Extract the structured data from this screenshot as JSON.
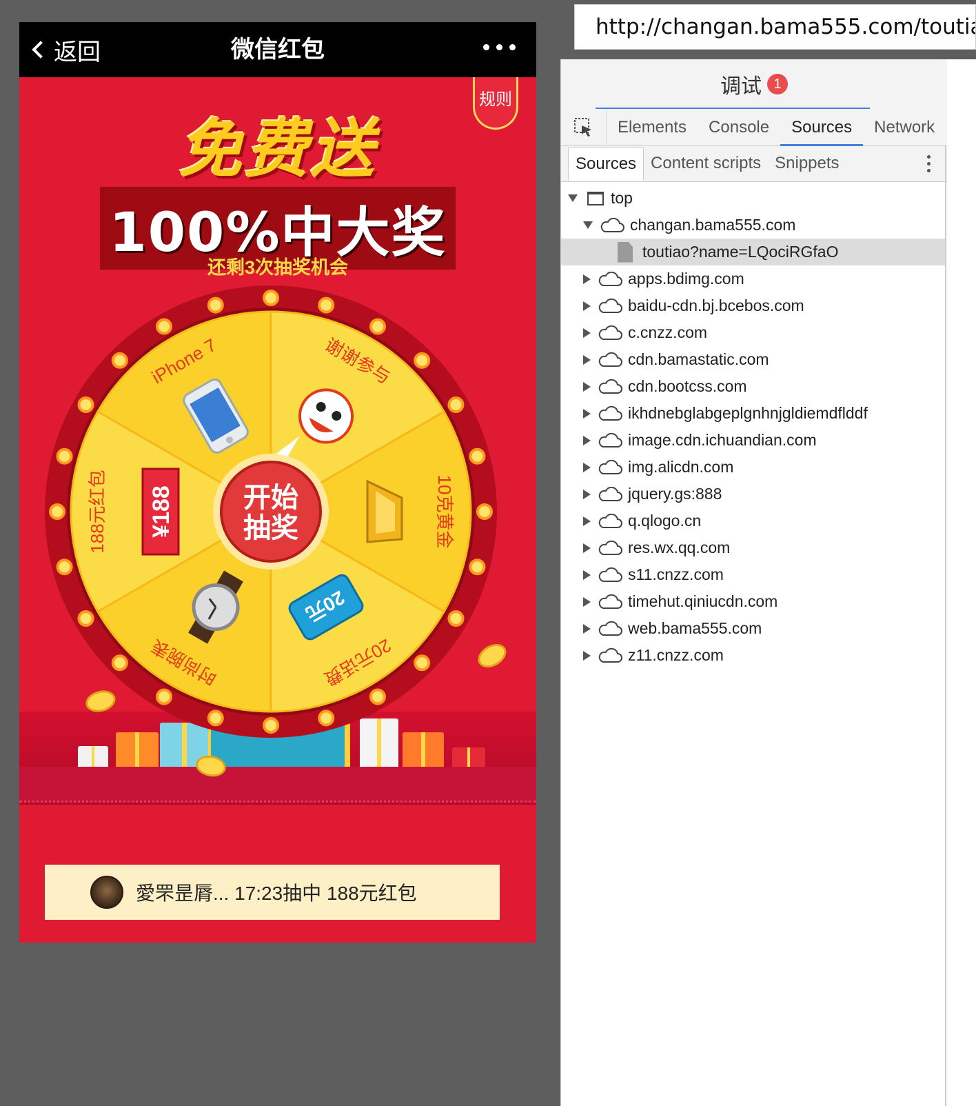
{
  "phone": {
    "back_label": "返回",
    "title": "微信红包",
    "rules_label": "规则",
    "headline_line1": "免费送",
    "headline_line2": "100%中大奖",
    "chances_text": "还剩3次抽奖机会",
    "start_button_line1": "开始",
    "start_button_line2": "抽奖",
    "wheel_segments": [
      {
        "label": "iPhone 7",
        "icon": "phone-icon"
      },
      {
        "label": "谢谢参与",
        "icon": "lion-dance-icon"
      },
      {
        "label": "10克黄金",
        "icon": "gold-bar-icon"
      },
      {
        "label": "20元话费",
        "icon": "phone-credit-card-icon",
        "card_text": "20元"
      },
      {
        "label": "时尚腕表",
        "icon": "watch-icon"
      },
      {
        "label": "188元红包",
        "icon": "red-envelope-icon",
        "card_text": "¥188"
      }
    ],
    "winner": {
      "text": "愛罘昰脣... 17:23抽中 188元红包"
    },
    "colors": {
      "background": "#e01a33",
      "wheel_rim": "#b40e1e",
      "wheel_yellow": "#fbd02b",
      "label_red": "#e23a1c"
    }
  },
  "browser": {
    "url": "http://changan.bama555.com/toutiao?name=LQociRGfaO"
  },
  "devtools": {
    "title": "调试",
    "error_count": "1",
    "tabs": [
      "Elements",
      "Console",
      "Sources",
      "Network"
    ],
    "active_tab": "Sources",
    "subtabs": [
      "Sources",
      "Content scripts",
      "Snippets"
    ],
    "active_subtab": "Sources",
    "tree": {
      "root": "top",
      "expanded_domain": "changan.bama555.com",
      "selected_file": "toutiao?name=LQociRGfaO",
      "domains": [
        "apps.bdimg.com",
        "baidu-cdn.bj.bcebos.com",
        "c.cnzz.com",
        "cdn.bamastatic.com",
        "cdn.bootcss.com",
        "ikhdnebglabgeplgnhnjgldiemdflddf",
        "image.cdn.ichuandian.com",
        "img.alicdn.com",
        "jquery.gs:888",
        "q.qlogo.cn",
        "res.wx.qq.com",
        "s11.cnzz.com",
        "timehut.qiniucdn.com",
        "web.bama555.com",
        "z11.cnzz.com"
      ]
    }
  }
}
